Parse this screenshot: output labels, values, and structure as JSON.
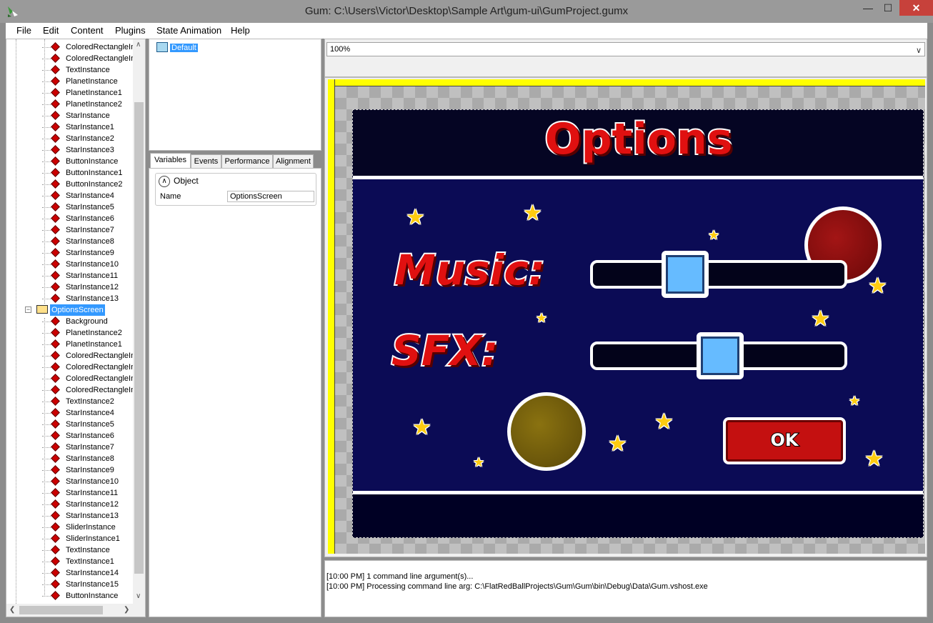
{
  "window": {
    "title": "Gum: C:\\Users\\Victor\\Desktop\\Sample Art\\gum-ui\\GumProject.gumx",
    "minimize": "—",
    "maximize": "☐",
    "close": "✕"
  },
  "menu": [
    "File",
    "Edit",
    "Content",
    "Plugins",
    "State Animation",
    "Help"
  ],
  "tree": {
    "upper_items": [
      "ColoredRectangleIn",
      "ColoredRectangleIn",
      "TextInstance",
      "PlanetInstance",
      "PlanetInstance1",
      "PlanetInstance2",
      "StarInstance",
      "StarInstance1",
      "StarInstance2",
      "StarInstance3",
      "ButtonInstance",
      "ButtonInstance1",
      "ButtonInstance2",
      "StarInstance4",
      "StarInstance5",
      "StarInstance6",
      "StarInstance7",
      "StarInstance8",
      "StarInstance9",
      "StarInstance10",
      "StarInstance11",
      "StarInstance12",
      "StarInstance13"
    ],
    "screen_node": "OptionsScreen",
    "screen_expander": "−",
    "screen_children": [
      "Background",
      "PlanetInstance2",
      "PlanetInstance1",
      "ColoredRectangleIn",
      "ColoredRectangleIn",
      "ColoredRectangleIn",
      "ColoredRectangleIn",
      "TextInstance2",
      "StarInstance4",
      "StarInstance5",
      "StarInstance6",
      "StarInstance7",
      "StarInstance8",
      "StarInstance9",
      "StarInstance10",
      "StarInstance11",
      "StarInstance12",
      "StarInstance13",
      "SliderInstance",
      "SliderInstance1",
      "TextInstance",
      "TextInstance1",
      "StarInstance14",
      "StarInstance15",
      "ButtonInstance"
    ],
    "scroll_up": "∧",
    "scroll_down": "∨",
    "scroll_left": "❮",
    "scroll_right": "❯"
  },
  "states": {
    "items": [
      "Default"
    ]
  },
  "tabs": [
    "Variables",
    "Events",
    "Performance",
    "Alignment"
  ],
  "properties": {
    "category_toggle": "∧",
    "category": "Object",
    "name_label": "Name",
    "name_value": "OptionsScreen"
  },
  "zoom": {
    "value": "100%",
    "caret": "∨"
  },
  "game": {
    "title": "Options",
    "music_label": "Music:",
    "sfx_label": "SFX:",
    "music_slider_level": 0.35,
    "sfx_slider_level": 0.52,
    "ok_label": "OK",
    "star_glyph": "★",
    "colors": {
      "title_red": "#e01010",
      "background_navy": "#0b0b55",
      "slider_thumb": "#66bbff",
      "button_red": "#c41010",
      "planet_red": "#8a0a0a",
      "planet_olive": "#7a6410"
    }
  },
  "output": {
    "lines": [
      "[10:00 PM] 1 command line argument(s)...",
      "[10:00 PM] Processing command line arg: C:\\FlatRedBallProjects\\Gum\\Gum\\bin\\Debug\\Data\\Gum.vshost.exe"
    ]
  }
}
